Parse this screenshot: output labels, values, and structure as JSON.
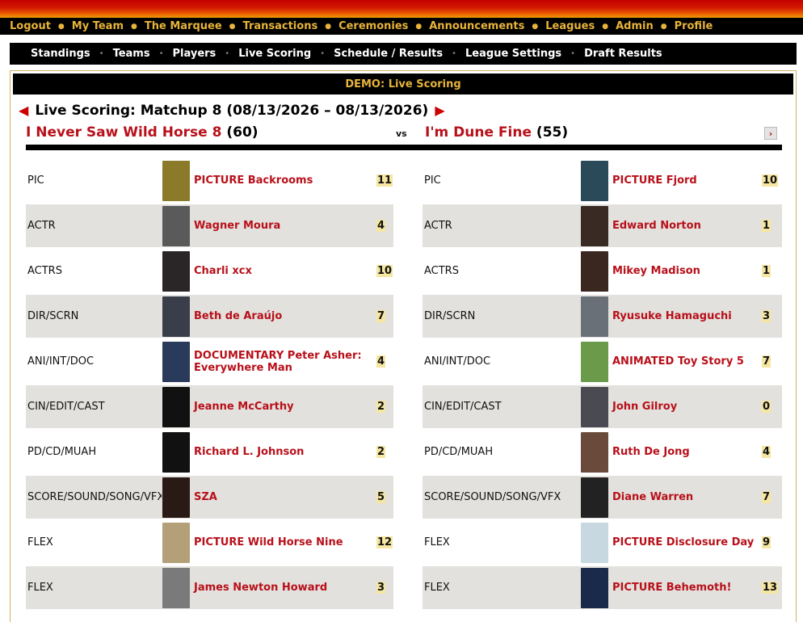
{
  "main_nav": [
    "Logout",
    "My Team",
    "The Marquee",
    "Transactions",
    "Ceremonies",
    "Announcements",
    "Leagues",
    "Admin",
    "Profile"
  ],
  "sub_nav": [
    "Standings",
    "Teams",
    "Players",
    "Live Scoring",
    "Schedule / Results",
    "League Settings",
    "Draft Results"
  ],
  "banner": "DEMO: Live Scoring",
  "matchup": {
    "title": "Live Scoring: Matchup 8 (08/13/2026 – 08/13/2026)",
    "vs": "vs",
    "left_team": {
      "name": "I Never Saw Wild Horse 8",
      "score": "(60)"
    },
    "right_team": {
      "name": "I'm Dune Fine",
      "score": "(55)"
    }
  },
  "icons": {
    "prev": "left-arrow-icon",
    "next": "right-arrow-icon",
    "next_matchup": "chevron-right-icon"
  },
  "colors": {
    "accent": "#b8101a",
    "nav_gold": "#e7b33a",
    "row_shade": "#e3e1dd",
    "points_bg": "#f5e6a1"
  },
  "rows": [
    {
      "left": {
        "pos": "PIC",
        "name": "PICTURE Backrooms",
        "pts": "11",
        "img": "#8a7a2a"
      },
      "right": {
        "pos": "PIC",
        "name": "PICTURE Fjord",
        "pts": "10",
        "img": "#2a4a5a"
      }
    },
    {
      "left": {
        "pos": "ACTR",
        "name": "Wagner Moura",
        "pts": "4",
        "img": "#5a5a5a"
      },
      "right": {
        "pos": "ACTR",
        "name": "Edward Norton",
        "pts": "1",
        "img": "#3a2a24"
      }
    },
    {
      "left": {
        "pos": "ACTRS",
        "name": "Charli xcx",
        "pts": "10",
        "img": "#2a2628"
      },
      "right": {
        "pos": "ACTRS",
        "name": "Mikey Madison",
        "pts": "1",
        "img": "#3a2820"
      }
    },
    {
      "left": {
        "pos": "DIR/SCRN",
        "name": "Beth de Araújo",
        "pts": "7",
        "img": "#3a3e4a"
      },
      "right": {
        "pos": "DIR/SCRN",
        "name": "Ryusuke Hamaguchi",
        "pts": "3",
        "img": "#6a7078"
      }
    },
    {
      "left": {
        "pos": "ANI/INT/DOC",
        "name": "DOCUMENTARY Peter Asher: Everywhere Man",
        "pts": "4",
        "img": "#2a3a5a"
      },
      "right": {
        "pos": "ANI/INT/DOC",
        "name": "ANIMATED Toy Story 5",
        "pts": "7",
        "img": "#6a9a4a"
      }
    },
    {
      "left": {
        "pos": "CIN/EDIT/CAST",
        "name": "Jeanne McCarthy",
        "pts": "2",
        "img": "#111111"
      },
      "right": {
        "pos": "CIN/EDIT/CAST",
        "name": "John Gilroy",
        "pts": "0",
        "img": "#4a4a52"
      }
    },
    {
      "left": {
        "pos": "PD/CD/MUAH",
        "name": "Richard L. Johnson",
        "pts": "2",
        "img": "#111111"
      },
      "right": {
        "pos": "PD/CD/MUAH",
        "name": "Ruth De Jong",
        "pts": "4",
        "img": "#6a4a3a"
      }
    },
    {
      "left": {
        "pos": "SCORE/SOUND/SONG/VFX",
        "name": "SZA",
        "pts": "5",
        "img": "#2a1a16"
      },
      "right": {
        "pos": "SCORE/SOUND/SONG/VFX",
        "name": "Diane Warren",
        "pts": "7",
        "img": "#222222"
      }
    },
    {
      "left": {
        "pos": "FLEX",
        "name": "PICTURE Wild Horse Nine",
        "pts": "12",
        "img": "#b4a078"
      },
      "right": {
        "pos": "FLEX",
        "name": "PICTURE Disclosure Day",
        "pts": "9",
        "img": "#c8d8e0"
      }
    },
    {
      "left": {
        "pos": "FLEX",
        "name": "James Newton Howard",
        "pts": "3",
        "img": "#7a7a7a"
      },
      "right": {
        "pos": "FLEX",
        "name": "PICTURE Behemoth!",
        "pts": "13",
        "img": "#1a2a4a"
      }
    }
  ]
}
